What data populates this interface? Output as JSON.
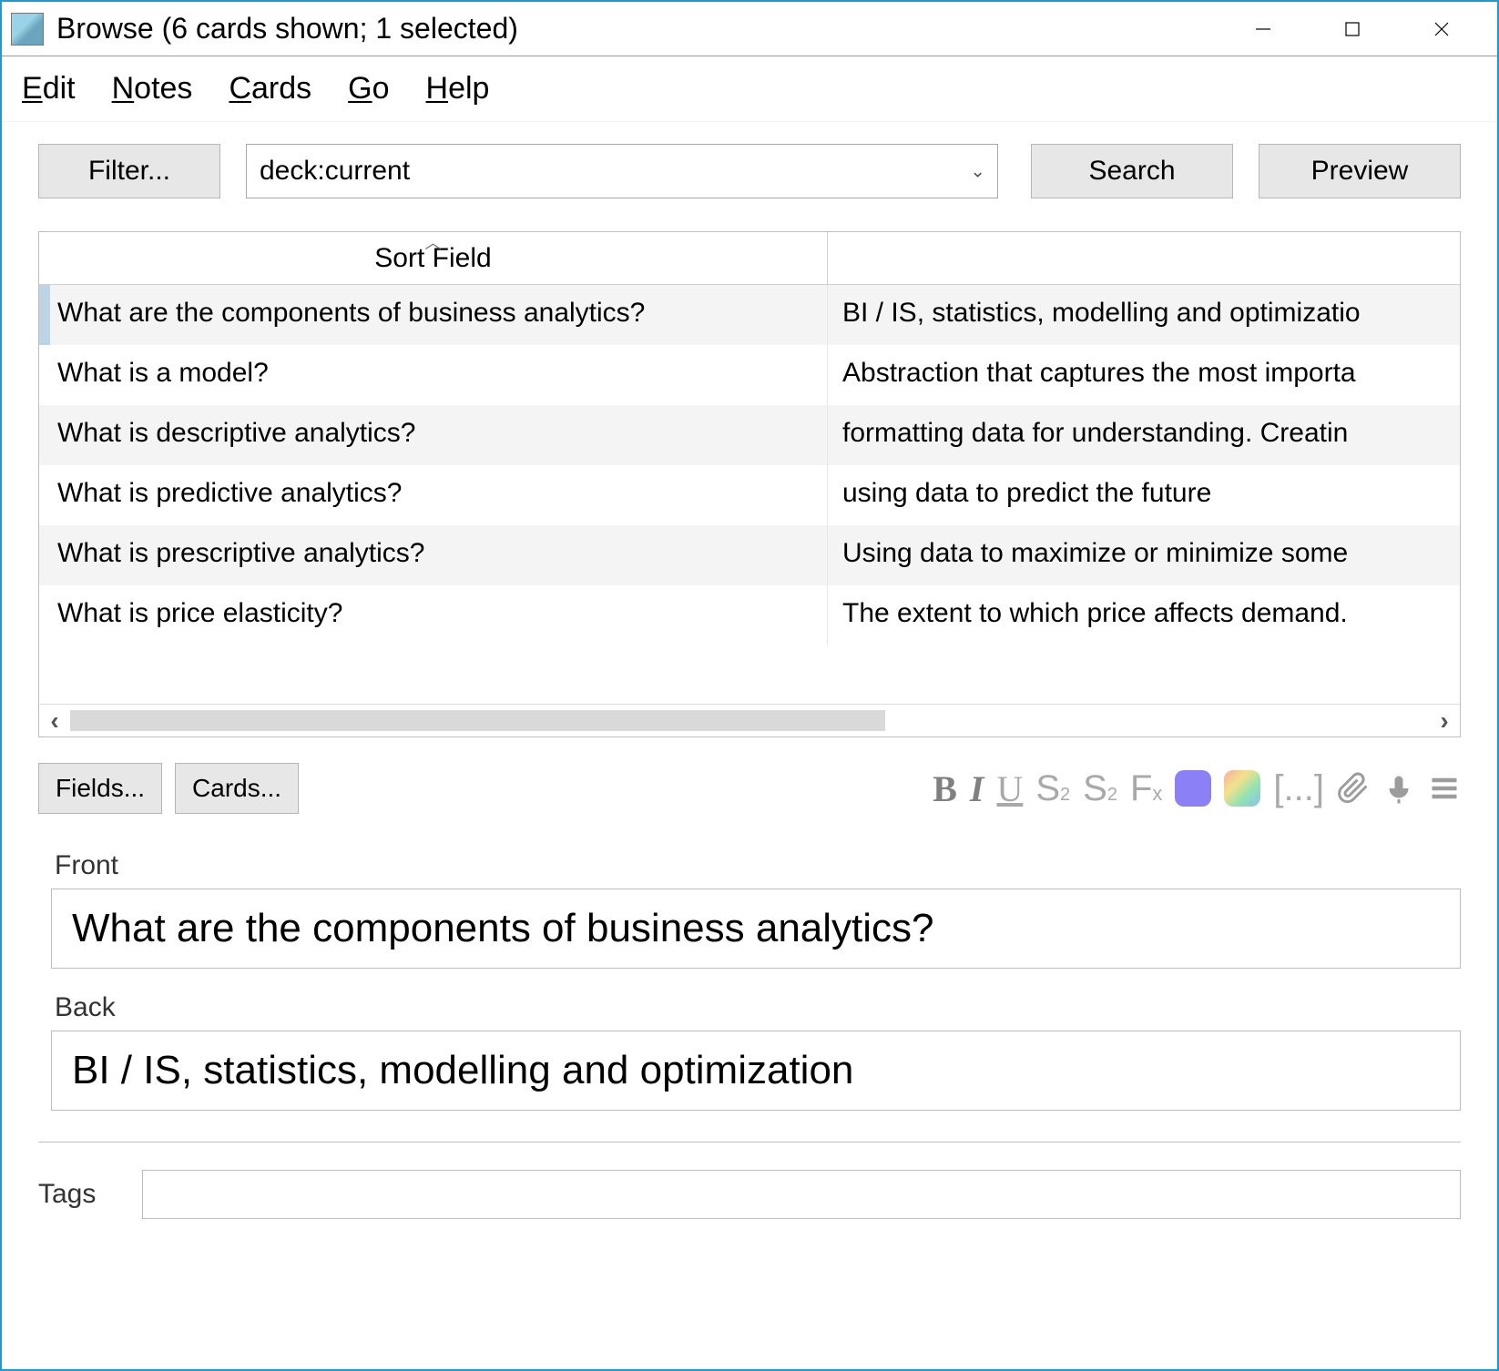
{
  "window": {
    "title": "Browse (6 cards shown; 1 selected)"
  },
  "menubar": [
    "Edit",
    "Notes",
    "Cards",
    "Go",
    "Help"
  ],
  "toolbar": {
    "filter_label": "Filter...",
    "search_value": "deck:current ",
    "search_label": "Search",
    "preview_label": "Preview"
  },
  "table": {
    "sort_header": "Sort Field",
    "rows": [
      {
        "front": "What are the components of business analytics?",
        "back": "BI / IS, statistics, modelling and optimizatio",
        "selected": true
      },
      {
        "front": "What is a model?",
        "back": "Abstraction that captures the most importa"
      },
      {
        "front": "What is descriptive analytics?",
        "back": "formatting data for understanding. Creatin"
      },
      {
        "front": "What is predictive analytics?",
        "back": "using data to predict the future"
      },
      {
        "front": "What is prescriptive analytics?",
        "back": "Using data to maximize or minimize some"
      },
      {
        "front": "What is price elasticity?",
        "back": "The extent to which price affects demand."
      }
    ]
  },
  "editor": {
    "fields_label": "Fields...",
    "cards_label": "Cards...",
    "front_label": "Front",
    "back_label": "Back",
    "front_value": "What are the components of business analytics?",
    "back_value": "BI / IS, statistics, modelling and optimization",
    "tags_label": "Tags",
    "tags_value": ""
  }
}
